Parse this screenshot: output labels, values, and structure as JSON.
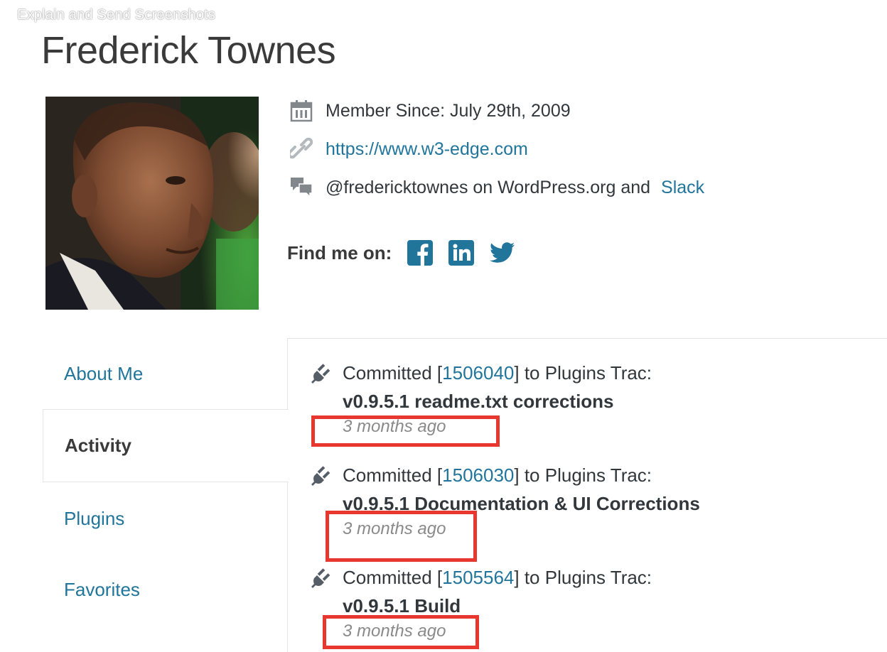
{
  "watermark": "Explain and Send Screenshots",
  "profile": {
    "name": "Frederick Townes",
    "member_since": "Member Since: July 29th, 2009",
    "website": "https://www.w3-edge.com",
    "handle_text": "@fredericktownes on WordPress.org and ",
    "slack_label": "Slack",
    "find_me_label": "Find me on:"
  },
  "icons": {
    "calendar": "calendar-icon",
    "link": "link-icon",
    "chat": "chat-icon",
    "facebook": "facebook-icon",
    "linkedin": "linkedin-icon",
    "twitter": "twitter-icon",
    "plugin": "plugin-icon"
  },
  "colors": {
    "link": "#21759b",
    "highlight": "#e8372e",
    "social": "#21759b"
  },
  "tabs": [
    {
      "label": "About Me"
    },
    {
      "label": "Activity"
    },
    {
      "label": "Plugins"
    },
    {
      "label": "Favorites"
    }
  ],
  "activity": [
    {
      "prefix": "Committed [",
      "rev": "1506040",
      "suffix": "] to Plugins Trac:",
      "message": "v0.9.5.1 readme.txt corrections",
      "time": "3 months ago"
    },
    {
      "prefix": "Committed [",
      "rev": "1506030",
      "suffix": "] to Plugins Trac:",
      "message": "v0.9.5.1 Documentation & UI Corrections",
      "time": "3 months ago"
    },
    {
      "prefix": "Committed [",
      "rev": "1505564",
      "suffix": "] to Plugins Trac:",
      "message": "v0.9.5.1 Build",
      "time": "3 months ago"
    }
  ]
}
